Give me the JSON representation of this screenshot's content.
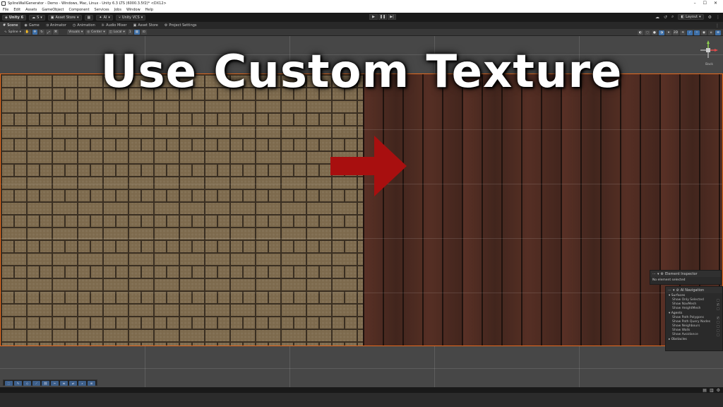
{
  "window": {
    "title": "SplineWallGenerator - Demo - Windows, Mac, Linux - Unity 6.3 LTS (6000.3.5f2)* <DX12>",
    "controls": [
      "–",
      "☐",
      "✕"
    ]
  },
  "menu": [
    "File",
    "Edit",
    "Assets",
    "GameObject",
    "Component",
    "Services",
    "Jobs",
    "Window",
    "Help"
  ],
  "toolbar": {
    "unity_label": "Unity 6",
    "account_label": "S",
    "asset_store": "Asset Store",
    "ai_label": "AI",
    "vcs_label": "Unity VCS",
    "layout_label": "Layout"
  },
  "tabs": [
    "Scene",
    "Game",
    "Animator",
    "Animation",
    "Audio Mixer",
    "Asset Store",
    "Project Settings"
  ],
  "scene_toolbar": {
    "spline_label": "Spline",
    "visuals_label": "Visuals",
    "pivot_label": "Center",
    "space_label": "Local",
    "grid_value": "1"
  },
  "overlay": {
    "headline": "Use Custom Texture",
    "gizmo_back_label": "Back"
  },
  "element_inspector": {
    "title": "Element Inspector",
    "status": "No element selected"
  },
  "ai_navigation": {
    "title": "AI Navigation",
    "surfaces": {
      "label": "Surfaces",
      "items": [
        {
          "label": "Show Only Selected",
          "checked": false
        },
        {
          "label": "Show NavMesh",
          "checked": true
        },
        {
          "label": "Show HeightMesh",
          "checked": false
        }
      ]
    },
    "agents": {
      "label": "Agents",
      "items": [
        {
          "label": "Show Path Polygons",
          "checked": true
        },
        {
          "label": "Show Path Query Nodes",
          "checked": false
        },
        {
          "label": "Show Neighbours",
          "checked": false
        },
        {
          "label": "Show Walls",
          "checked": false
        },
        {
          "label": "Show Avoidance",
          "checked": false
        }
      ]
    },
    "obstacles_label": "Obstacles"
  },
  "colors": {
    "accent_orange": "#e56a1f",
    "arrow_red": "#a80f0f",
    "toolbar_blue": "#3d6fa8"
  }
}
